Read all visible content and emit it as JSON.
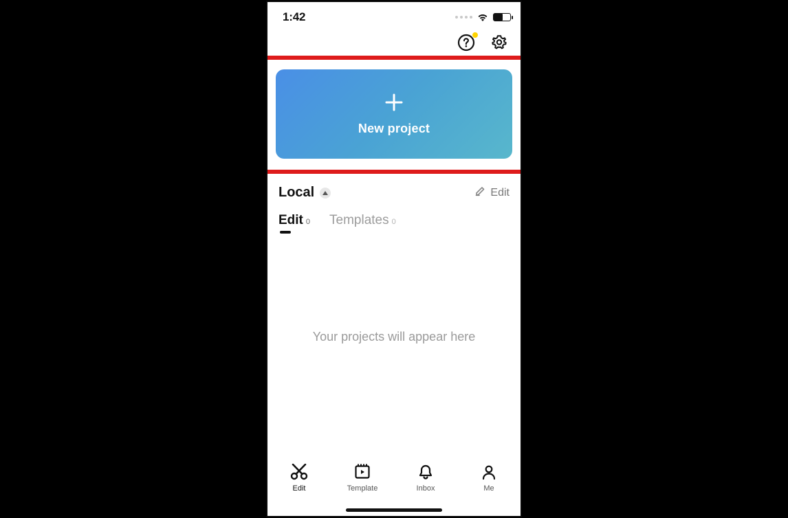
{
  "status_bar": {
    "time": "1:42"
  },
  "cta": {
    "new_project_label": "New project"
  },
  "section": {
    "title": "Local",
    "edit_link": "Edit"
  },
  "tabs": {
    "edit": {
      "label": "Edit",
      "count": "0"
    },
    "templates": {
      "label": "Templates",
      "count": "0"
    }
  },
  "empty_message": "Your projects will appear here",
  "bottom_nav": {
    "edit": "Edit",
    "template": "Template",
    "inbox": "Inbox",
    "me": "Me"
  },
  "colors": {
    "highlight": "#de1b1b",
    "accent_gradient_start": "#4a8fe6",
    "accent_gradient_end": "#58b7cc",
    "notification_dot": "#ffd400"
  }
}
